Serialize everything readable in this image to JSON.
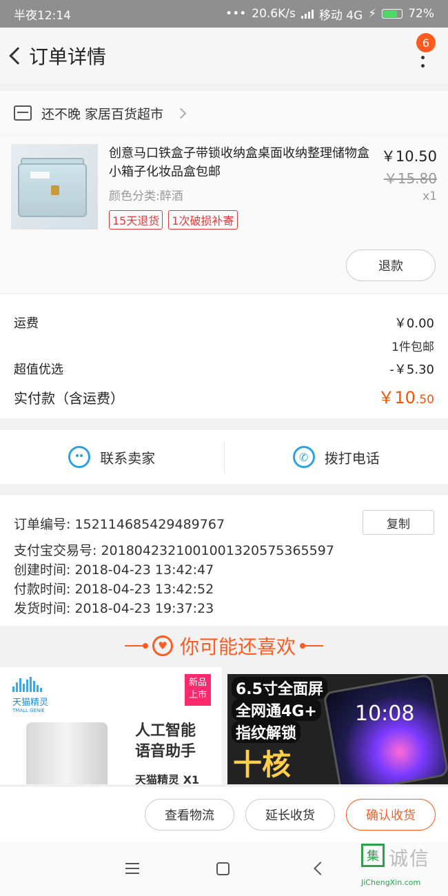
{
  "status_bar": {
    "time": "半夜12:14",
    "network_speed": "20.6K/s",
    "carrier": "移动 4G",
    "battery": "72%"
  },
  "header": {
    "title": "订单详情",
    "badge_count": "6"
  },
  "shop": {
    "name": "还不晚 家居百货超市"
  },
  "product": {
    "title": "创意马口铁盒子带锁收纳盒桌面收纳整理储物盒小箱子化妆品盒包邮",
    "variant": "颜色分类:醉酒",
    "tags": [
      "15天退货",
      "1次破损补寄"
    ],
    "price": "￥10.50",
    "original_price": "￥15.80",
    "quantity": "x1",
    "refund_label": "退款"
  },
  "fees": {
    "shipping_label": "运费",
    "shipping_value": "￥0.00",
    "shipping_note": "1件包邮",
    "discount_label": "超值优选",
    "discount_value": "-￥5.30",
    "total_label": "实付款（含运费）",
    "total_currency_int": "￥10",
    "total_decimal": ".50"
  },
  "contact": {
    "seller": "联系卖家",
    "call": "拨打电话"
  },
  "order_info": {
    "order_no": "订单编号:  152114685429489767",
    "alipay_no": "支付宝交易号:  2018042321001001320575365597",
    "created": "创建时间:  2018-04-23 13:42:47",
    "paid": "付款时间:  2018-04-23 13:42:52",
    "shipped": "发货时间:  2018-04-23 19:37:23",
    "copy_label": "复制"
  },
  "recommend": {
    "title": "你可能还喜欢",
    "left": {
      "brand": "天猫精灵",
      "brand_en": "TMALL GENIE",
      "new_tag_1": "新品",
      "new_tag_2": "上市",
      "line1": "人工智能",
      "line2": "语音助手",
      "product": "天猫精灵 X1"
    },
    "right": {
      "line1": "6.5寸全面屏",
      "line2": "全网通4G+",
      "line3": "指纹解锁",
      "big": "十核",
      "phone_time": "10:08"
    }
  },
  "actions": {
    "logistics": "查看物流",
    "extend": "延长收货",
    "confirm": "确认收货"
  },
  "watermark": {
    "mark": "集",
    "text": "诚信",
    "url": "JiChengXin.com"
  },
  "colors": {
    "accent": "#ff5a1f",
    "blue": "#2aa3e0",
    "tag_red": "#e4393c"
  }
}
